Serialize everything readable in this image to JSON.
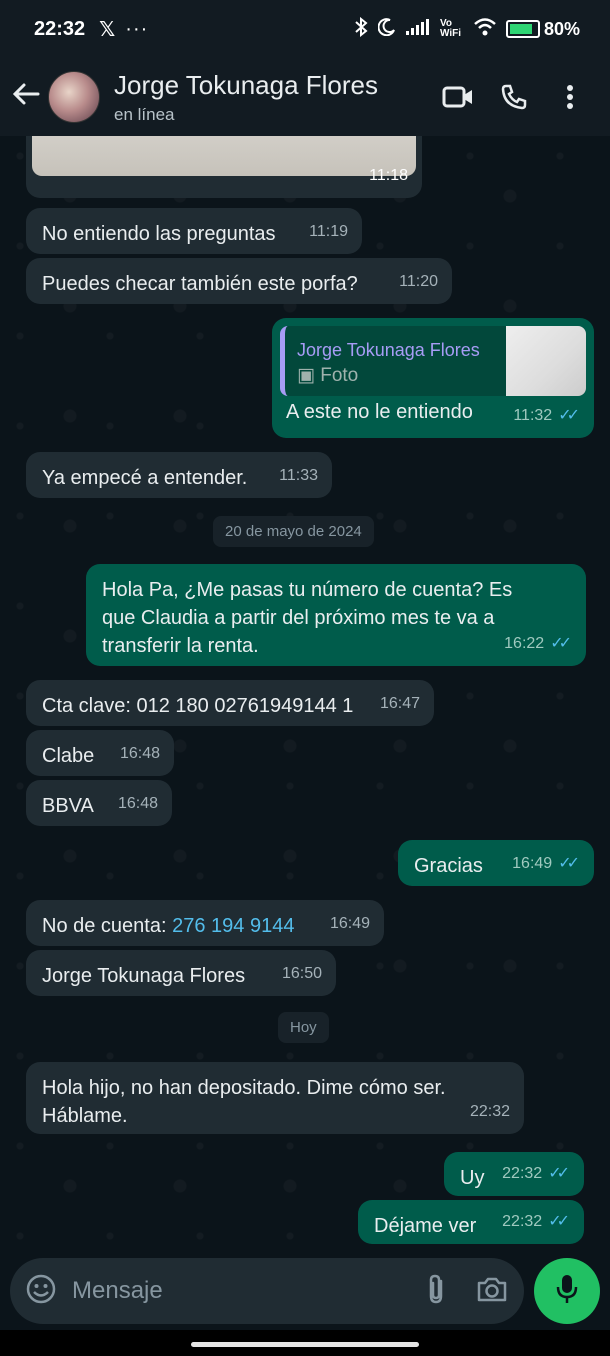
{
  "status_bar": {
    "time": "22:32",
    "x_app": "𝕏",
    "more": "···",
    "volte": "Vo WiFi",
    "battery": "80%"
  },
  "header": {
    "contact_name": "Jorge Tokunaga Flores",
    "status": "en línea"
  },
  "messages": [
    {
      "id": "m0",
      "type": "image",
      "dir": "in",
      "time": "11:18"
    },
    {
      "id": "m1",
      "dir": "in",
      "text": "No entiendo las preguntas",
      "time": "11:19"
    },
    {
      "id": "m2",
      "dir": "in",
      "text": "Puedes checar también este porfa?",
      "time": "11:20"
    },
    {
      "id": "m3",
      "dir": "out",
      "reply_to_name": "Jorge Tokunaga Flores",
      "reply_to_type": "Foto",
      "text": "A este no le entiendo",
      "time": "11:32"
    },
    {
      "id": "m4",
      "dir": "in",
      "text": "Ya empecé a entender.",
      "time": "11:33"
    },
    {
      "id": "d1",
      "type": "date",
      "text": "20 de mayo de 2024"
    },
    {
      "id": "m5",
      "dir": "out",
      "text_lines": [
        "Hola Pa, ¿Me pasas tu número de cuenta? Es",
        "que Claudia a partir del próximo mes te va a",
        "transferir la renta."
      ],
      "time": "16:22"
    },
    {
      "id": "m6",
      "dir": "in",
      "text": "Cta clave: 012 180 02761949144 1",
      "time": "16:47"
    },
    {
      "id": "m7",
      "dir": "in",
      "text": "Clabe",
      "time": "16:48"
    },
    {
      "id": "m8",
      "dir": "in",
      "text": "BBVA",
      "time": "16:48"
    },
    {
      "id": "m9",
      "dir": "out",
      "text": "Gracias",
      "time": "16:49"
    },
    {
      "id": "m10",
      "dir": "in",
      "prefix": "No de cuenta: ",
      "link": "276 194 9144",
      "time": "16:49"
    },
    {
      "id": "m11",
      "dir": "in",
      "text": "Jorge Tokunaga Flores",
      "time": "16:50"
    },
    {
      "id": "d2",
      "type": "date",
      "text": "Hoy"
    },
    {
      "id": "m12",
      "dir": "in",
      "text_lines": [
        "Hola hijo, no han depositado. Dime cómo ser.",
        "Háblame."
      ],
      "time": "22:32"
    },
    {
      "id": "m13",
      "dir": "out",
      "text": "Uy",
      "time": "22:32"
    },
    {
      "id": "m14",
      "dir": "out",
      "text": "Déjame ver",
      "time": "22:32"
    }
  ],
  "composer": {
    "placeholder": "Mensaje"
  },
  "icons": [
    "back-arrow-icon",
    "video-call-icon",
    "voice-call-icon",
    "more-vert-icon",
    "emoji-icon",
    "attach-icon",
    "camera-icon",
    "mic-icon",
    "read-receipt-icon",
    "photo-icon"
  ],
  "colors": {
    "incoming_bubble": "#202c33",
    "outgoing_bubble": "#005c4b",
    "read_ticks": "#53bdeb",
    "mic_button": "#21c063",
    "reply_accent": "#a79cf5"
  }
}
